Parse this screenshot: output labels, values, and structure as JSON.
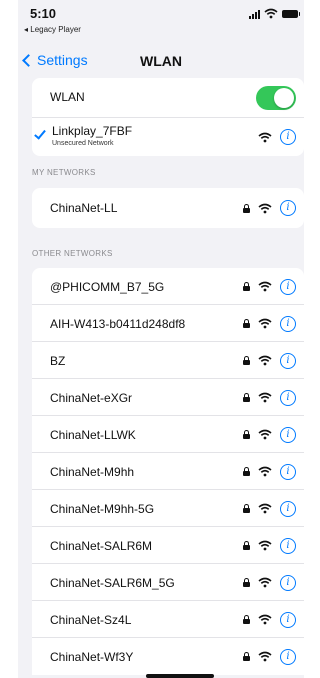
{
  "status_bar": {
    "time": "5:10",
    "back_app": "◂ Legacy Player",
    "icons": [
      "cellular-signal-icon",
      "wifi-icon",
      "battery-icon"
    ]
  },
  "nav": {
    "back_label": "Settings",
    "title": "WLAN"
  },
  "wlan_group": {
    "toggle_label": "WLAN",
    "toggle_on": true,
    "connected_name": "Linkplay_7FBF",
    "connected_subtitle": "Unsecured Network"
  },
  "my_networks": {
    "header": "MY NETWORKS",
    "items": [
      {
        "name": "ChinaNet-LL",
        "locked": true
      }
    ]
  },
  "other_networks": {
    "header": "OTHER NETWORKS",
    "items": [
      {
        "name": "@PHICOMM_B7_5G",
        "locked": true
      },
      {
        "name": "AIH-W413-b0411d248df8",
        "locked": true
      },
      {
        "name": "BZ",
        "locked": true
      },
      {
        "name": "ChinaNet-eXGr",
        "locked": true
      },
      {
        "name": "ChinaNet-LLWK",
        "locked": true
      },
      {
        "name": "ChinaNet-M9hh",
        "locked": true
      },
      {
        "name": "ChinaNet-M9hh-5G",
        "locked": true
      },
      {
        "name": "ChinaNet-SALR6M",
        "locked": true
      },
      {
        "name": "ChinaNet-SALR6M_5G",
        "locked": true
      },
      {
        "name": "ChinaNet-Sz4L",
        "locked": true
      },
      {
        "name": "ChinaNet-Wf3Y",
        "locked": true
      }
    ]
  },
  "colors": {
    "accent": "#007aff",
    "toggle_on": "#34c759",
    "background": "#f2f2f6"
  }
}
